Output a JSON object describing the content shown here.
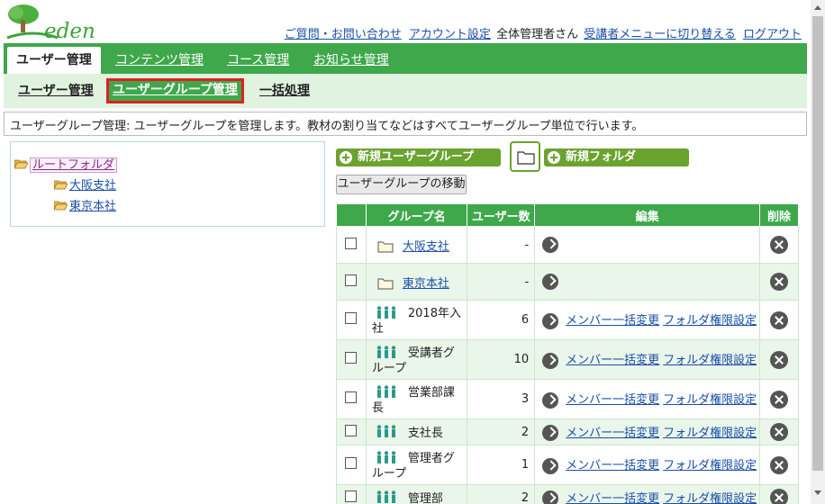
{
  "header": {
    "logo_text": "eden",
    "links": {
      "contact": "ご質問・お問い合わせ",
      "account": "アカウント設定",
      "user_name": "全体管理者さん",
      "switch_menu": "受講者メニューに切り替える",
      "logout": "ログアウト"
    }
  },
  "main_tabs": [
    "ユーザー管理",
    "コンテンツ管理",
    "コース管理",
    "お知らせ管理"
  ],
  "sub_tabs": [
    "ユーザー管理",
    "ユーザーグループ管理",
    "一括処理"
  ],
  "description": "ユーザーグループ管理: ユーザーグループを管理します。教材の割り当てなどはすべてユーザーグループ単位で行います。",
  "tree": {
    "root": "ルートフォルダ",
    "children": [
      "大阪支社",
      "東京本社"
    ]
  },
  "actions": {
    "new_group": "新規ユーザーグループ",
    "new_folder": "新規フォルダ",
    "move": "ユーザーグループの移動"
  },
  "table": {
    "headers": [
      "グループ名",
      "ユーザー数",
      "編集",
      "削除"
    ],
    "edit_links": {
      "members": "メンバー一括変更",
      "permissions": "フォルダ権限設定"
    },
    "rows": [
      {
        "type": "folder",
        "name": "大阪支社",
        "count": "-"
      },
      {
        "type": "folder",
        "name": "東京本社",
        "count": "-"
      },
      {
        "type": "group",
        "name_line1": "2018年入",
        "name_line2": "社",
        "count": "6"
      },
      {
        "type": "group",
        "name_line1": "受講者グ",
        "name_line2": "ループ",
        "count": "10"
      },
      {
        "type": "group",
        "name_line1": "営業部課",
        "name_line2": "長",
        "count": "3"
      },
      {
        "type": "group",
        "name_line1": "支社長",
        "name_line2": "",
        "count": "2"
      },
      {
        "type": "group",
        "name_line1": "管理者グ",
        "name_line2": "ループ",
        "count": "1"
      },
      {
        "type": "group",
        "name_line1": "管理部",
        "name_line2": "",
        "count": "2"
      }
    ]
  }
}
